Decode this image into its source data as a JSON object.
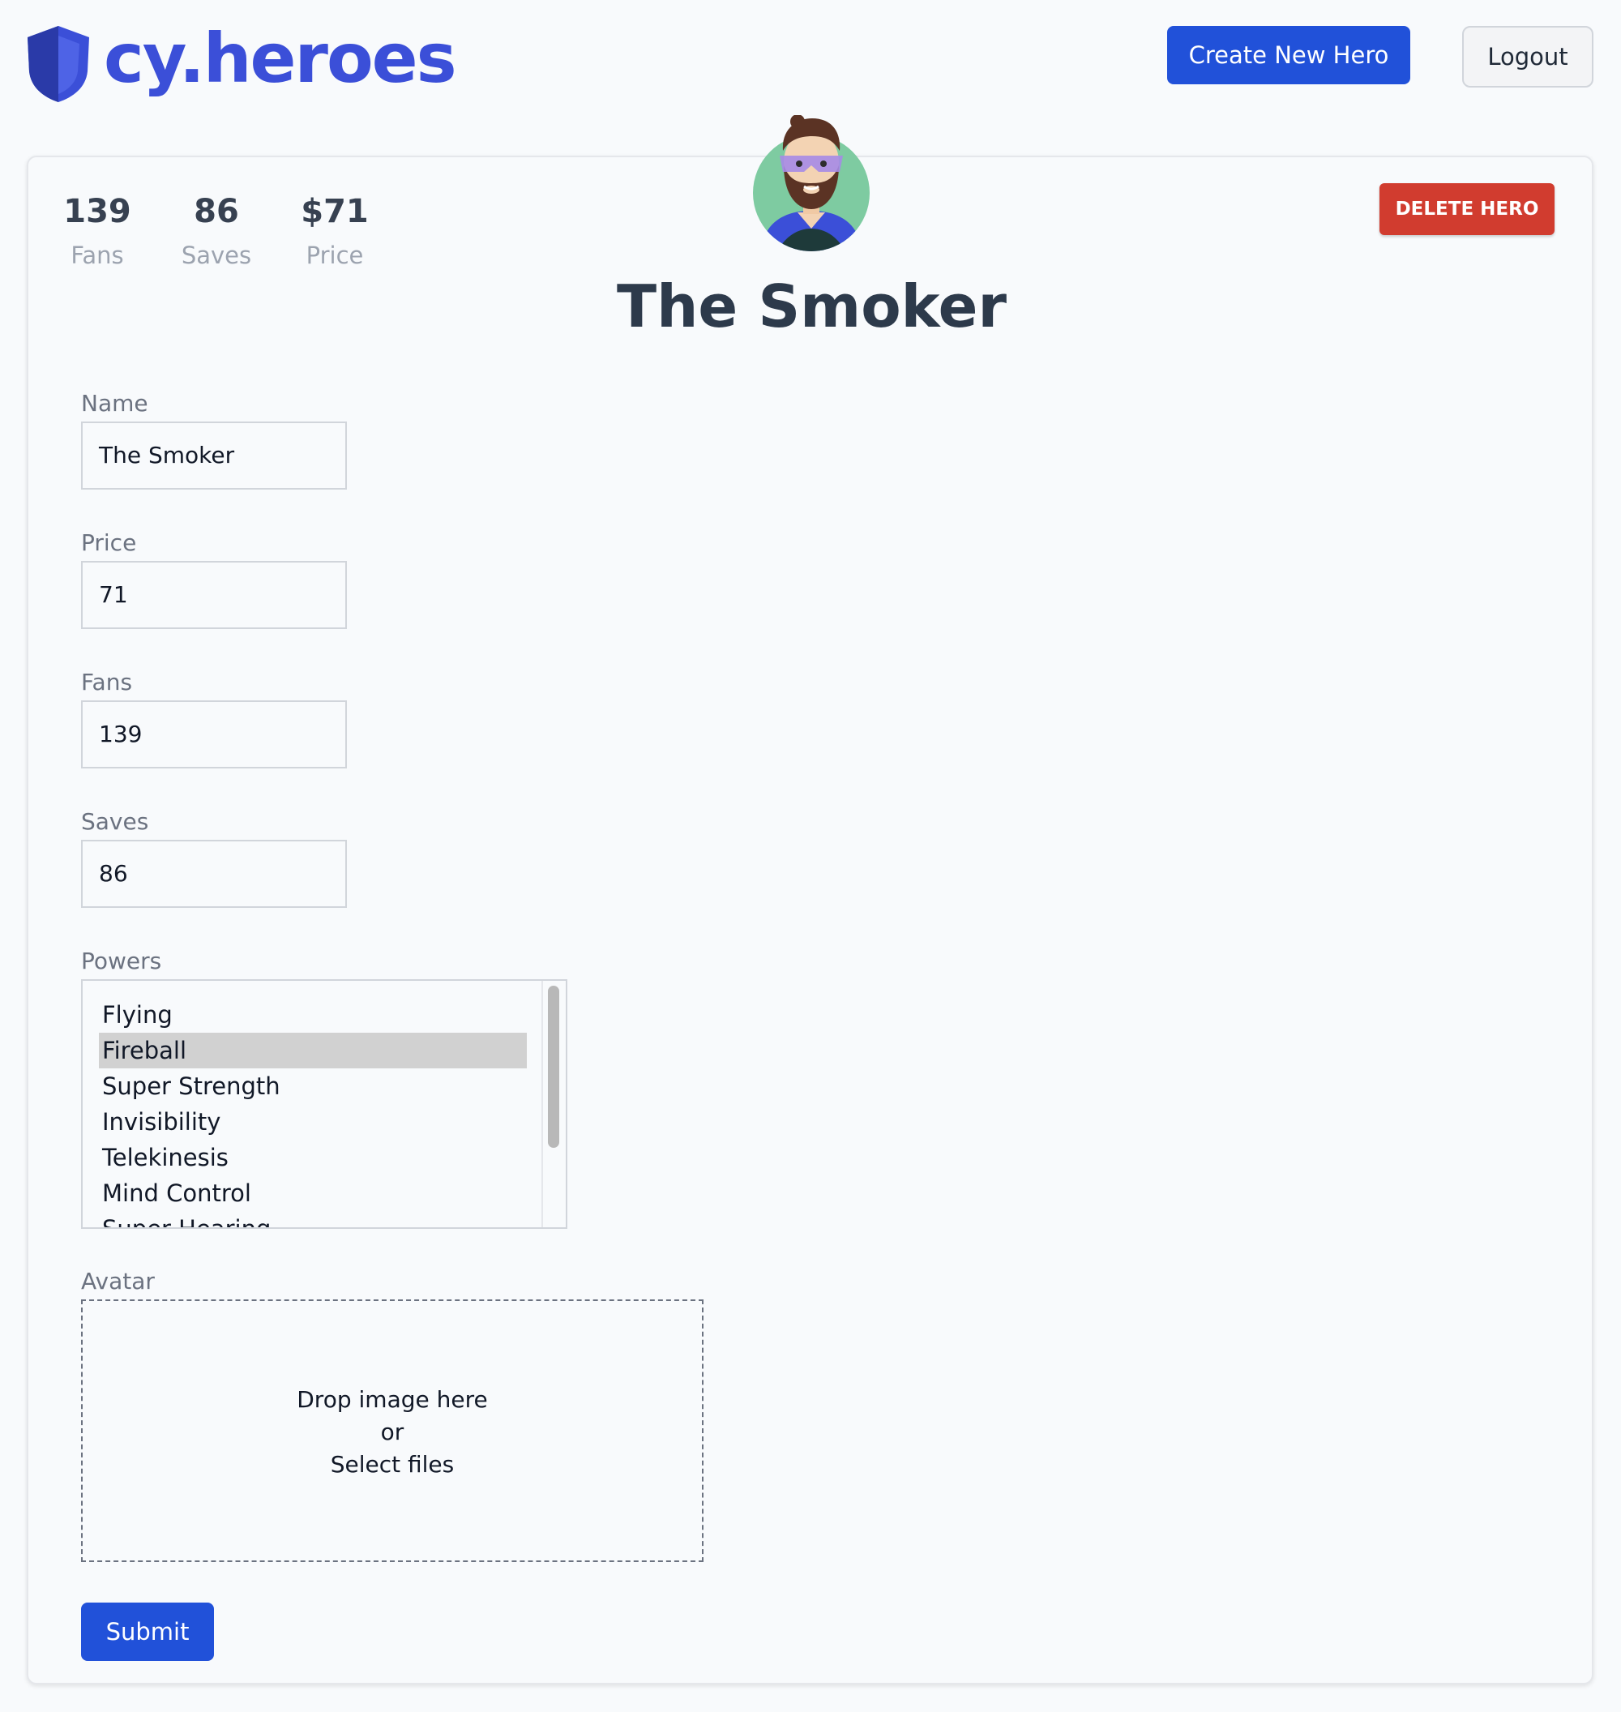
{
  "brand": {
    "name": "cy.heroes",
    "icon": "shield-icon",
    "color": "#3b4fd8"
  },
  "header": {
    "create_label": "Create New Hero",
    "logout_label": "Logout"
  },
  "stats": [
    {
      "value": "139",
      "label": "Fans"
    },
    {
      "value": "86",
      "label": "Saves"
    },
    {
      "value": "$71",
      "label": "Price"
    }
  ],
  "hero": {
    "title": "The Smoker",
    "avatar_icon": "bearded-hero-avatar-icon"
  },
  "delete_label": "DELETE HERO",
  "form": {
    "name_label": "Name",
    "name_value": "The Smoker",
    "price_label": "Price",
    "price_value": "71",
    "fans_label": "Fans",
    "fans_value": "139",
    "saves_label": "Saves",
    "saves_value": "86",
    "powers_label": "Powers",
    "powers": [
      "Flying",
      "Fireball",
      "Super Strength",
      "Invisibility",
      "Telekinesis",
      "Mind Control",
      "Super Hearing"
    ],
    "selected_power": "Fireball",
    "avatar_label": "Avatar",
    "dropzone": {
      "line1": "Drop image here",
      "line2": "or",
      "line3": "Select files"
    },
    "submit_label": "Submit"
  },
  "colors": {
    "primary": "#2151d9",
    "danger": "#d13c2f",
    "background": "#f8fafc"
  }
}
